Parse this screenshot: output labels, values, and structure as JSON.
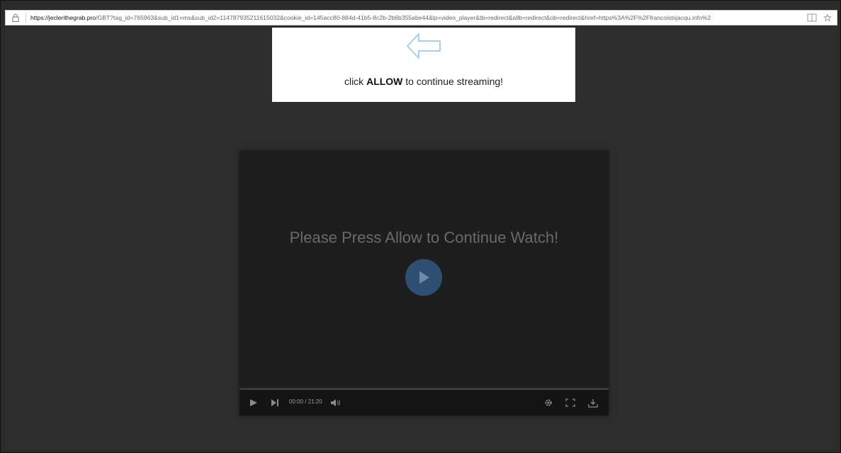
{
  "browser": {
    "url_host": "https://jeclerithegrab.pro",
    "url_rest": "/GBT?tag_id=765963&sub_id1=ms&sub_id2=114787935211615032&cookie_id=145acc80-884d-41b5-8c2b-2b6b355abe44&lp=video_player&tb=redirect&allb=redirect&ob=redirect&href=https%3A%2F%2Ffrancoistsjacqu.info%2"
  },
  "prompt": {
    "pre": "click ",
    "bold": "ALLOW",
    "post": " to continue streaming!"
  },
  "player": {
    "message": "Please Press Allow to Continue Watch!",
    "time": "00:00 / 21:20",
    "progress": 0
  },
  "icons": [
    "lock-icon",
    "reader-view-icon",
    "star-icon",
    "left-arrow-icon",
    "play-icon",
    "skip-next-icon",
    "volume-icon",
    "settings-icon",
    "fullscreen-icon",
    "download-icon"
  ],
  "colors": {
    "page_bg": "#2d2d2d",
    "player_bg": "#1d1d1d",
    "play_button": "#2f4f72",
    "arrow": "#a9cdf0"
  }
}
